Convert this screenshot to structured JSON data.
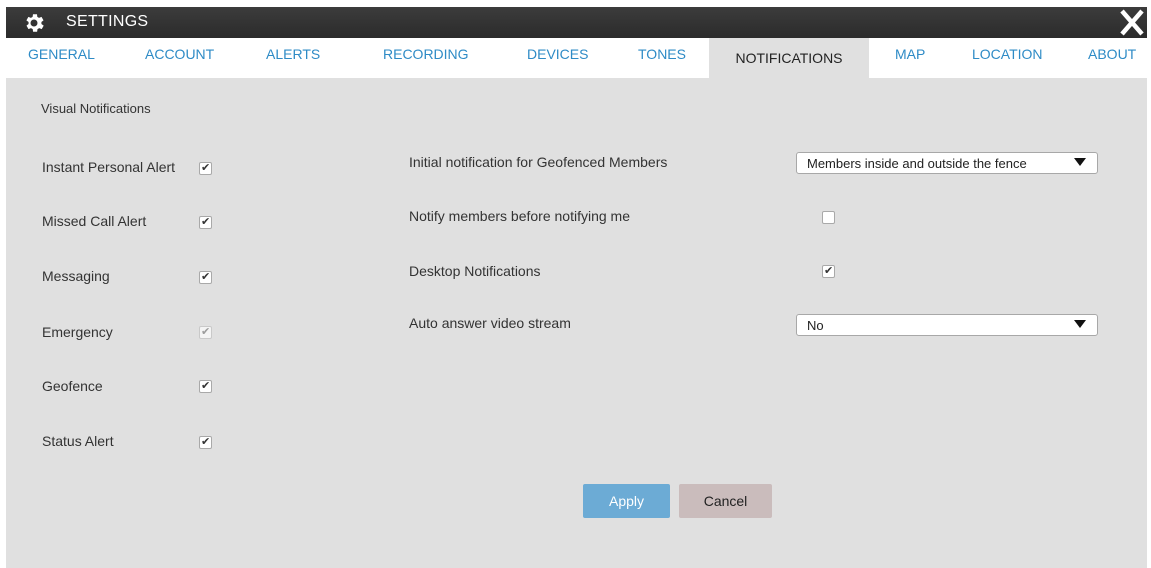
{
  "titlebar": {
    "title": "SETTINGS",
    "icon": "gear-icon",
    "close_icon": "close-icon"
  },
  "tabs": [
    {
      "label": "GENERAL",
      "active": false
    },
    {
      "label": "ACCOUNT",
      "active": false
    },
    {
      "label": "ALERTS",
      "active": false
    },
    {
      "label": "RECORDING",
      "active": false
    },
    {
      "label": "DEVICES",
      "active": false
    },
    {
      "label": "TONES",
      "active": false
    },
    {
      "label": "NOTIFICATIONS",
      "active": true
    },
    {
      "label": "MAP",
      "active": false
    },
    {
      "label": "LOCATION",
      "active": false
    },
    {
      "label": "ABOUT",
      "active": false
    }
  ],
  "visual_notifications": {
    "title": "Visual Notifications",
    "items": [
      {
        "label": "Instant Personal Alert",
        "checked": true,
        "disabled": false
      },
      {
        "label": "Missed Call Alert",
        "checked": true,
        "disabled": false
      },
      {
        "label": "Messaging",
        "checked": true,
        "disabled": false
      },
      {
        "label": "Emergency",
        "checked": true,
        "disabled": true
      },
      {
        "label": "Geofence",
        "checked": true,
        "disabled": false
      },
      {
        "label": "Status Alert",
        "checked": true,
        "disabled": false
      }
    ]
  },
  "options": {
    "geofence": {
      "label": "Initial notification for Geofenced Members",
      "value": "Members inside and outside the fence"
    },
    "notify_members": {
      "label": "Notify members before notifying me",
      "checked": false
    },
    "desktop": {
      "label": "Desktop Notifications",
      "checked": true
    },
    "auto_answer": {
      "label": "Auto answer video stream",
      "value": "No"
    }
  },
  "buttons": {
    "apply": "Apply",
    "cancel": "Cancel"
  },
  "colors": {
    "tab_link": "#2e8bc6",
    "apply_bg": "#6cabd5",
    "cancel_bg": "#cabcbc",
    "titlebar_bg": "#2b2b2b",
    "panel_bg": "#e0e0e0"
  }
}
